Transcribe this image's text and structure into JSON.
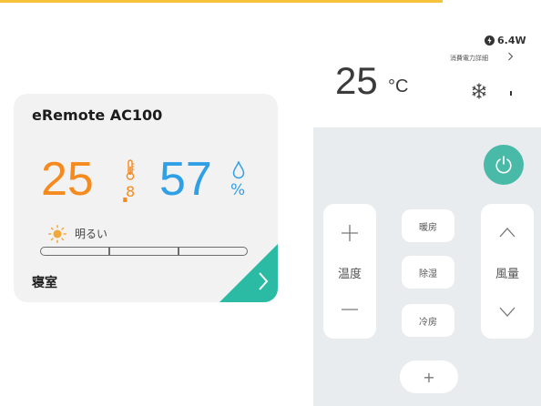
{
  "colors": {
    "accent_teal": "#2bbba4",
    "temperature_orange": "#f58a1f",
    "humidity_blue": "#2f9fe6",
    "top_accent_yellow": "#f6c23a",
    "power_button": "#49b9a8"
  },
  "widget": {
    "device_name": "eRemote AC100",
    "temperature_integer": "25",
    "temperature_dot": ".",
    "temperature_decimal": "8",
    "humidity_value": "57",
    "humidity_unit": "%",
    "brightness_label": "明るい",
    "brightness_level_segments": 3,
    "room_name": "寝室",
    "icons": [
      "thermometer-icon",
      "water-drop-icon",
      "sun-icon",
      "chevron-right-icon"
    ]
  },
  "remote": {
    "set_temperature": "25",
    "set_temperature_unit": "°C",
    "power_usage": "6.4W",
    "power_detail_label": "消費電力詳細",
    "power_detail_arrow": ">",
    "mode_icon": "snowflake-icon",
    "temp_control": {
      "plus": "+",
      "label": "温度",
      "minus": "—"
    },
    "fan_control": {
      "label": "風量"
    },
    "modes": [
      {
        "label": "暖房"
      },
      {
        "label": "除湿"
      },
      {
        "label": "冷房"
      }
    ],
    "add_button": "+"
  }
}
